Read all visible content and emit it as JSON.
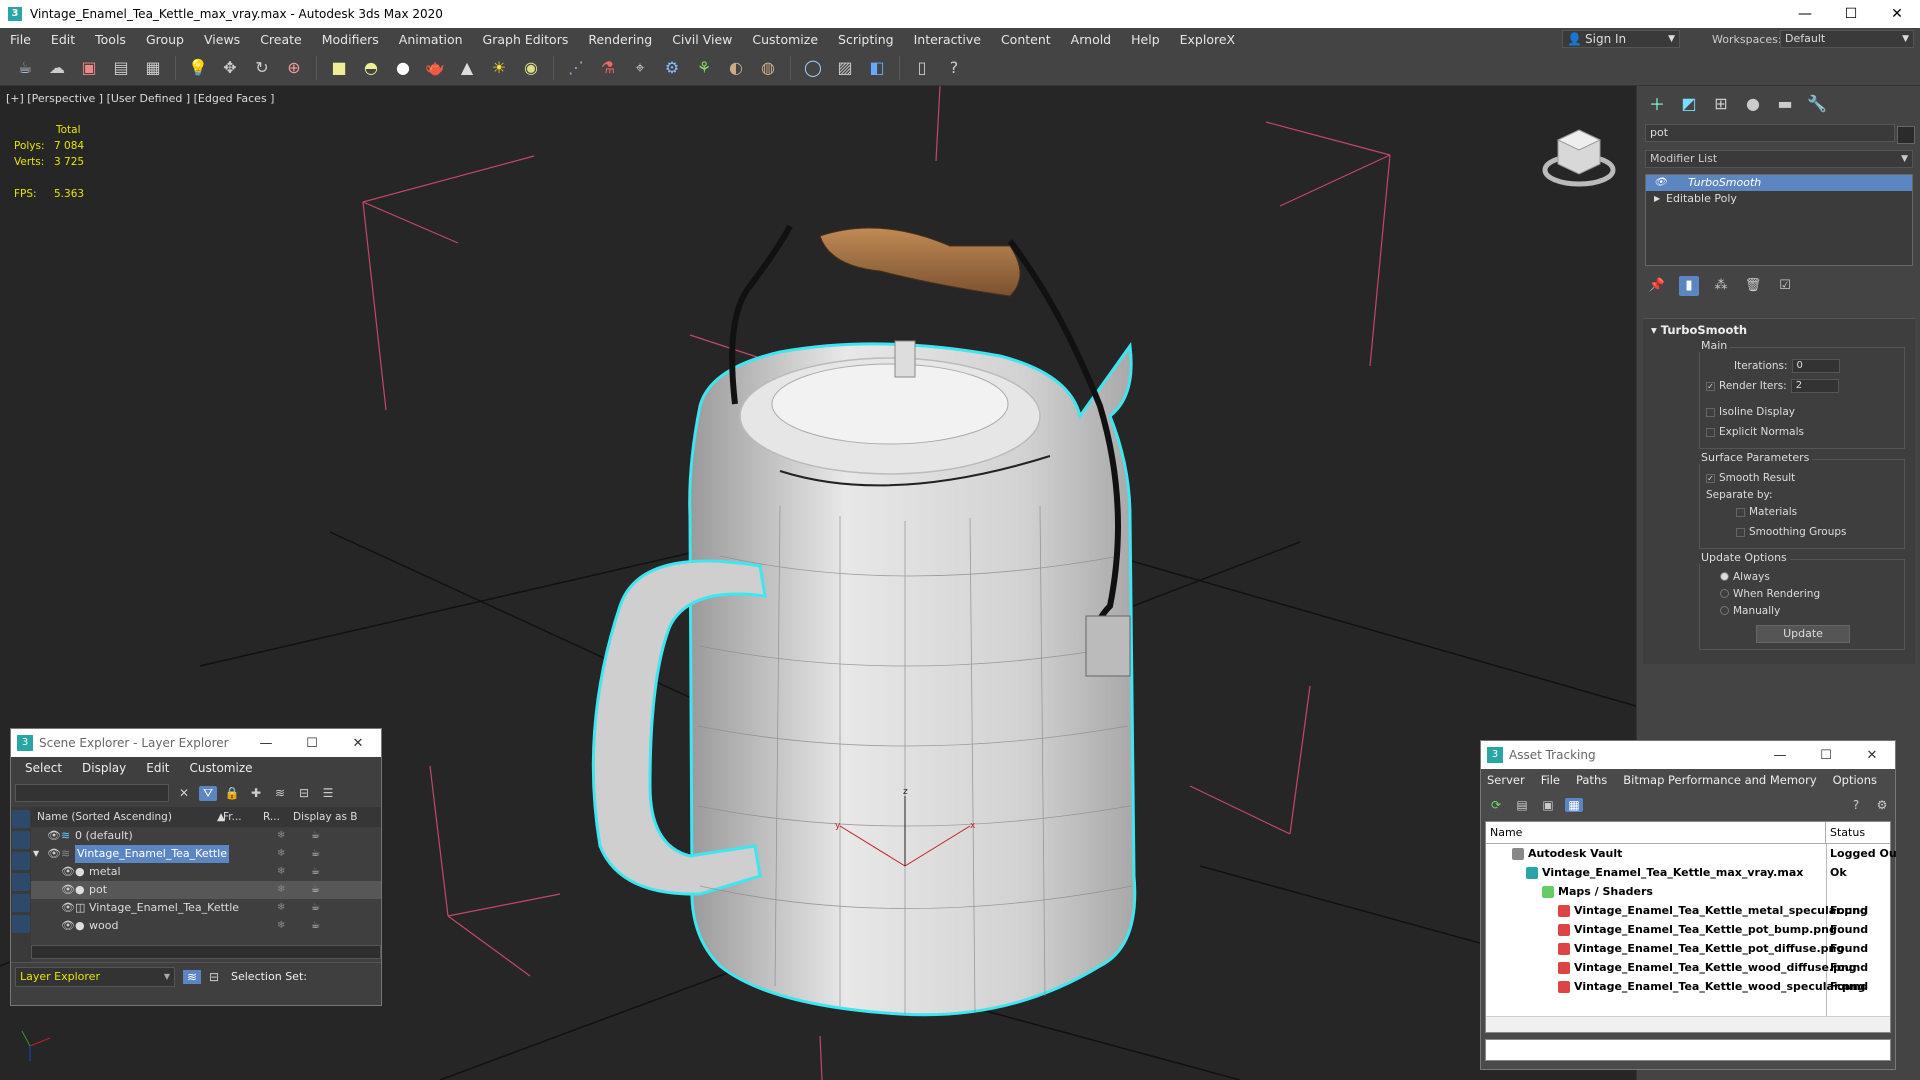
{
  "window": {
    "title": "Vintage_Enamel_Tea_Kettle_max_vray.max - Autodesk 3ds Max 2020",
    "app_icon": "3"
  },
  "menu": [
    "File",
    "Edit",
    "Tools",
    "Group",
    "Views",
    "Create",
    "Modifiers",
    "Animation",
    "Graph Editors",
    "Rendering",
    "Civil View",
    "Customize",
    "Scripting",
    "Interactive",
    "Content",
    "Arnold",
    "Help",
    "ExploreX"
  ],
  "signin": {
    "label": "Sign In"
  },
  "workspaces": {
    "label": "Workspaces:",
    "value": "Default"
  },
  "viewport": {
    "label": "[+] [Perspective ] [User Defined ] [Edged Faces ]",
    "stats": {
      "header": "Total",
      "polys_label": "Polys:",
      "polys": "7 084",
      "verts_label": "Verts:",
      "verts": "3 725",
      "fps_label": "FPS:",
      "fps": "5.363"
    },
    "gizmo": {
      "x": "x",
      "y": "y",
      "z": "z"
    }
  },
  "command_panel": {
    "object_name": "pot",
    "modifier_list": "Modifier List",
    "stack": [
      {
        "label": "TurboSmooth"
      },
      {
        "label": "Editable Poly"
      }
    ],
    "turbosmooth": {
      "title": "TurboSmooth",
      "main": "Main",
      "iterations_label": "Iterations:",
      "iterations": "0",
      "render_iters_label": "Render Iters:",
      "render_iters": "2",
      "isoline": "Isoline Display",
      "explicit": "Explicit Normals",
      "surface": "Surface Parameters",
      "smooth_result": "Smooth Result",
      "separate_by": "Separate by:",
      "materials": "Materials",
      "smoothing_groups": "Smoothing Groups",
      "update_options": "Update Options",
      "always": "Always",
      "when_rendering": "When Rendering",
      "manually": "Manually",
      "update": "Update"
    }
  },
  "scene_explorer": {
    "title": "Scene Explorer - Layer Explorer",
    "menu": [
      "Select",
      "Display",
      "Edit",
      "Customize"
    ],
    "columns": [
      "Name (Sorted Ascending)",
      "Fr...",
      "R...",
      "Display as B"
    ],
    "rows": [
      {
        "name": "0 (default)"
      },
      {
        "name": "Vintage_Enamel_Tea_Kettle"
      },
      {
        "name": "metal"
      },
      {
        "name": "pot"
      },
      {
        "name": "Vintage_Enamel_Tea_Kettle"
      },
      {
        "name": "wood"
      }
    ],
    "layer_explorer": "Layer Explorer",
    "selection_set": "Selection Set:"
  },
  "asset_tracking": {
    "title": "Asset Tracking",
    "menu": [
      "Server",
      "File",
      "Paths",
      "Bitmap Performance and Memory",
      "Options"
    ],
    "columns": [
      "Name",
      "Status"
    ],
    "rows": [
      {
        "name": "Autodesk Vault",
        "status": "Logged Ou"
      },
      {
        "name": "Vintage_Enamel_Tea_Kettle_max_vray.max",
        "status": "Ok"
      },
      {
        "name": "Maps / Shaders",
        "status": ""
      },
      {
        "name": "Vintage_Enamel_Tea_Kettle_metal_specular.png",
        "status": "Found"
      },
      {
        "name": "Vintage_Enamel_Tea_Kettle_pot_bump.png",
        "status": "Found"
      },
      {
        "name": "Vintage_Enamel_Tea_Kettle_pot_diffuse.png",
        "status": "Found"
      },
      {
        "name": "Vintage_Enamel_Tea_Kettle_wood_diffuse.png",
        "status": "Found"
      },
      {
        "name": "Vintage_Enamel_Tea_Kettle_wood_specular.png",
        "status": "Found"
      }
    ]
  },
  "colors": {
    "selection": "#5b86c2",
    "stats": "#e6e600",
    "outline": "#3ee6f0",
    "grid": "#111111"
  }
}
